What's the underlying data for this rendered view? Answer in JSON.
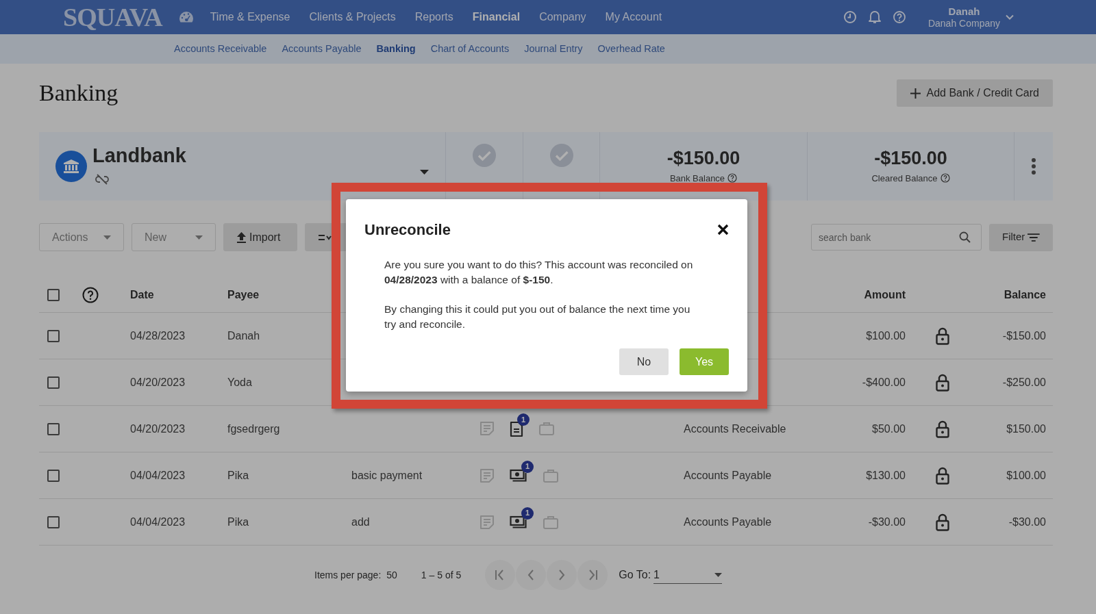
{
  "nav": {
    "logo": "SQUAVA",
    "items": [
      {
        "label": "Time & Expense",
        "selected": false
      },
      {
        "label": "Clients & Projects",
        "selected": false
      },
      {
        "label": "Reports",
        "selected": false
      },
      {
        "label": "Financial",
        "selected": true
      },
      {
        "label": "Company",
        "selected": false
      },
      {
        "label": "My Account",
        "selected": false
      }
    ],
    "user": {
      "name": "Danah",
      "company": "Danah Company"
    }
  },
  "subnav": [
    {
      "label": "Accounts Receivable",
      "selected": false
    },
    {
      "label": "Accounts Payable",
      "selected": false
    },
    {
      "label": "Banking",
      "selected": true
    },
    {
      "label": "Chart of Accounts",
      "selected": false
    },
    {
      "label": "Journal Entry",
      "selected": false
    },
    {
      "label": "Overhead Rate",
      "selected": false
    }
  ],
  "page": {
    "title": "Banking",
    "add_button": "Add Bank / Credit Card"
  },
  "bank": {
    "name": "Landbank",
    "balances": [
      {
        "amount": "-$150.00",
        "label": "Bank Balance"
      },
      {
        "amount": "-$150.00",
        "label": "Cleared Balance"
      }
    ]
  },
  "toolbar": {
    "actions": "Actions",
    "new": "New",
    "import": "Import",
    "search_placeholder": "search bank",
    "filter": "Filter"
  },
  "table": {
    "select_all_checked": false,
    "columns": [
      "Date",
      "Payee",
      "Amount",
      "Balance"
    ],
    "rows": [
      {
        "checked": false,
        "date": "04/28/2023",
        "payee": "Danah",
        "amount": "$100.00",
        "locked": true,
        "balance": "-$150.00"
      },
      {
        "checked": false,
        "date": "04/20/2023",
        "payee": "Yoda",
        "amount": "-$400.00",
        "locked": true,
        "balance": "-$250.00"
      },
      {
        "checked": false,
        "date": "04/20/2023",
        "payee": "fgsedrgerg",
        "attachment": {
          "kind": "document",
          "count": "1"
        },
        "account": "Accounts Receivable",
        "amount": "$50.00",
        "locked": true,
        "balance": "$150.00"
      },
      {
        "checked": false,
        "date": "04/04/2023",
        "payee": "Pika",
        "memo": "basic payment",
        "attachment": {
          "kind": "payment",
          "count": "1"
        },
        "account": "Accounts Payable",
        "amount": "$130.00",
        "locked": true,
        "balance": "$100.00"
      },
      {
        "checked": false,
        "date": "04/04/2023",
        "payee": "Pika",
        "memo": "add",
        "attachment": {
          "kind": "payment",
          "count": "1"
        },
        "account": "Accounts Payable",
        "amount": "-$30.00",
        "locked": true,
        "balance": "-$30.00"
      }
    ]
  },
  "pagination": {
    "items_label": "Items per page:",
    "items_value": "50",
    "range": "1 – 5 of 5",
    "goto_label": "Go To:",
    "goto_value": "1"
  },
  "dialog": {
    "title": "Unreconcile",
    "paragraphs": [
      "Are you sure you want to do this? This account was reconciled on **04/28/2023** with a balance of **$-150**.",
      "By changing this it could put you out of balance the next time you try and reconcile."
    ],
    "buttons": [
      {
        "label": "No",
        "kind": "secondary"
      },
      {
        "label": "Yes",
        "kind": "primary"
      }
    ]
  }
}
